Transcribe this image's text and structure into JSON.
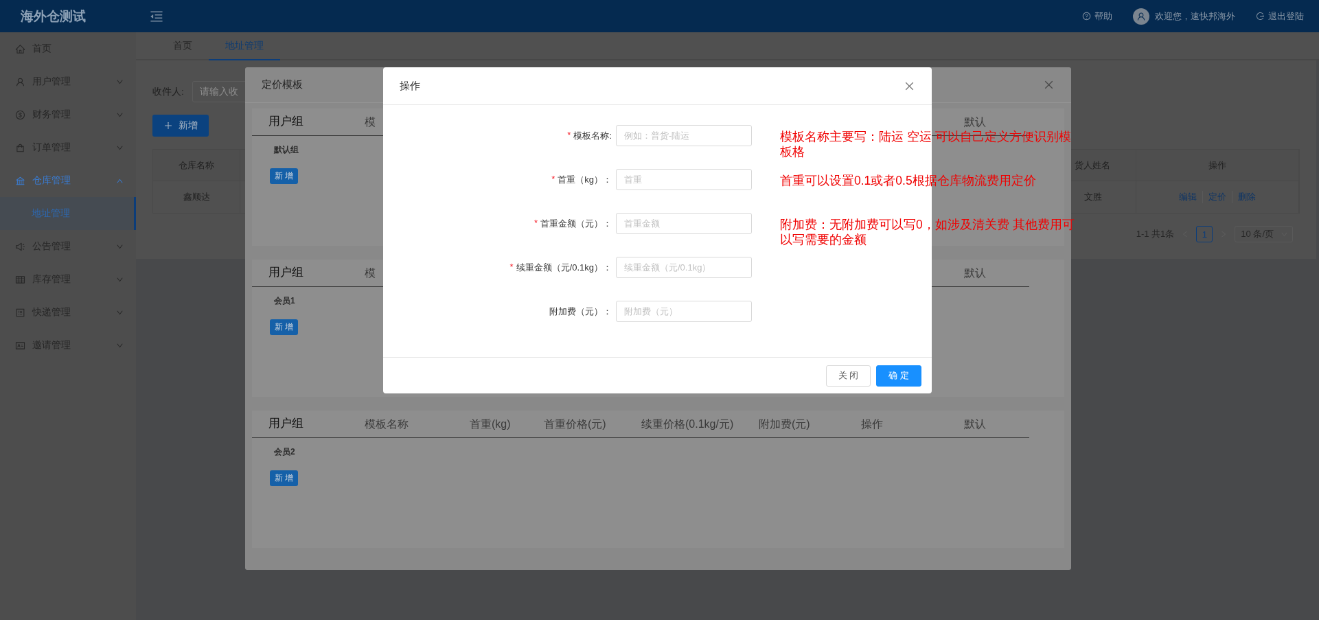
{
  "app": {
    "title": "海外仓测试"
  },
  "header": {
    "help": "帮助",
    "welcome": "欢迎您，速快邦海外",
    "logout": "退出登陆"
  },
  "sidebar": {
    "items": [
      {
        "label": "首页",
        "kind": "link",
        "selected": false
      },
      {
        "label": "用户管理",
        "kind": "group",
        "expanded": false,
        "selected": false
      },
      {
        "label": "财务管理",
        "kind": "group",
        "expanded": false,
        "selected": false
      },
      {
        "label": "订单管理",
        "kind": "group",
        "expanded": false,
        "selected": false
      },
      {
        "label": "仓库管理",
        "kind": "group",
        "expanded": true,
        "selected": false,
        "children": [
          {
            "label": "地址管理",
            "selected": true
          }
        ]
      },
      {
        "label": "公告管理",
        "kind": "group",
        "expanded": false,
        "selected": false
      },
      {
        "label": "库存管理",
        "kind": "group",
        "expanded": false,
        "selected": false
      },
      {
        "label": "快递管理",
        "kind": "group",
        "expanded": false,
        "selected": false
      },
      {
        "label": "邀请管理",
        "kind": "group",
        "expanded": false,
        "selected": false
      }
    ]
  },
  "tabs": [
    {
      "label": "首页",
      "selected": false
    },
    {
      "label": "地址管理",
      "selected": true
    }
  ],
  "filter": {
    "label": "收件人:",
    "placeholder": "请输入收"
  },
  "add_button": "新增",
  "table": {
    "columns": [
      "仓库名称",
      "货人姓名",
      "操作"
    ],
    "rows": [
      {
        "cells": [
          "鑫顺达",
          "文胜"
        ],
        "actions": [
          "编辑",
          "定价",
          "删除"
        ]
      }
    ]
  },
  "pagination": {
    "summary": "1-1 共1条",
    "pages": [
      {
        "label": "1",
        "selected": true
      }
    ],
    "page_size": "10 条/页"
  },
  "pricing_modal": {
    "title": "定价模板",
    "sections": [
      {
        "columns": [
          "用户组",
          "模",
          "默认"
        ],
        "group": "默认组",
        "add_button": "新 增"
      },
      {
        "columns": [
          "用户组",
          "模",
          "默认"
        ],
        "group": "会员1",
        "add_button": "新 增"
      },
      {
        "columns": [
          "用户组",
          "模板名称",
          "首重(kg)",
          "首重价格(元)",
          "续重价格(0.1kg/元)",
          "附加费(元)",
          "操作",
          "默认"
        ],
        "group": "会员2",
        "add_button": "新 增"
      }
    ]
  },
  "form_modal": {
    "title": "操作",
    "required_mark": "*",
    "fields": [
      {
        "label": "模板名称:",
        "placeholder": "例如：普货-陆运",
        "required": true,
        "note": "模板名称主要写：陆运 空运 可以自己定义方便识别模板格"
      },
      {
        "label": "首重（kg）：",
        "placeholder": "首重",
        "required": true,
        "note": "首重可以设置0.1或者0.5根据仓库物流费用定价"
      },
      {
        "label": "首重金额（元）：",
        "placeholder": "首重金额",
        "required": true,
        "note": "附加费：无附加费可以写0，如涉及清关费 其他费用可以写需要的金额"
      },
      {
        "label": "续重金额（元/0.1kg）：",
        "placeholder": "续重金额（元/0.1kg）",
        "required": true
      },
      {
        "label": "附加费（元）：",
        "placeholder": "附加费（元）",
        "required": false
      }
    ],
    "buttons": [
      {
        "label": "关 闭",
        "kind": "default"
      },
      {
        "label": "确 定",
        "kind": "primary"
      }
    ]
  }
}
